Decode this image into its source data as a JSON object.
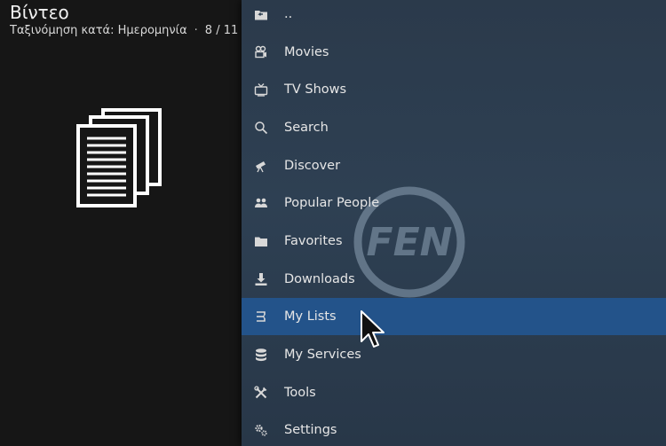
{
  "header": {
    "title": "Βίντεο",
    "sort_text": "Ταξινόμηση κατά: Ημερομηνία",
    "separator": "·",
    "position": "8 / 11"
  },
  "logo": {
    "text": "FEN"
  },
  "menu": {
    "items": [
      {
        "label": "..",
        "icon": "folder-back-icon"
      },
      {
        "label": "Movies",
        "icon": "film-camera-icon"
      },
      {
        "label": "TV Shows",
        "icon": "tv-icon"
      },
      {
        "label": "Search",
        "icon": "search-icon"
      },
      {
        "label": "Discover",
        "icon": "telescope-icon"
      },
      {
        "label": "Popular People",
        "icon": "people-icon"
      },
      {
        "label": "Favorites",
        "icon": "folder-icon"
      },
      {
        "label": "Downloads",
        "icon": "download-icon"
      },
      {
        "label": "My Lists",
        "icon": "list-icon",
        "focused": true
      },
      {
        "label": "My Services",
        "icon": "database-icon"
      },
      {
        "label": "Tools",
        "icon": "tools-icon"
      },
      {
        "label": "Settings",
        "icon": "gears-icon"
      }
    ]
  },
  "colors": {
    "focus": "#23538a",
    "panel": "#2e4053",
    "background": "#161616"
  }
}
